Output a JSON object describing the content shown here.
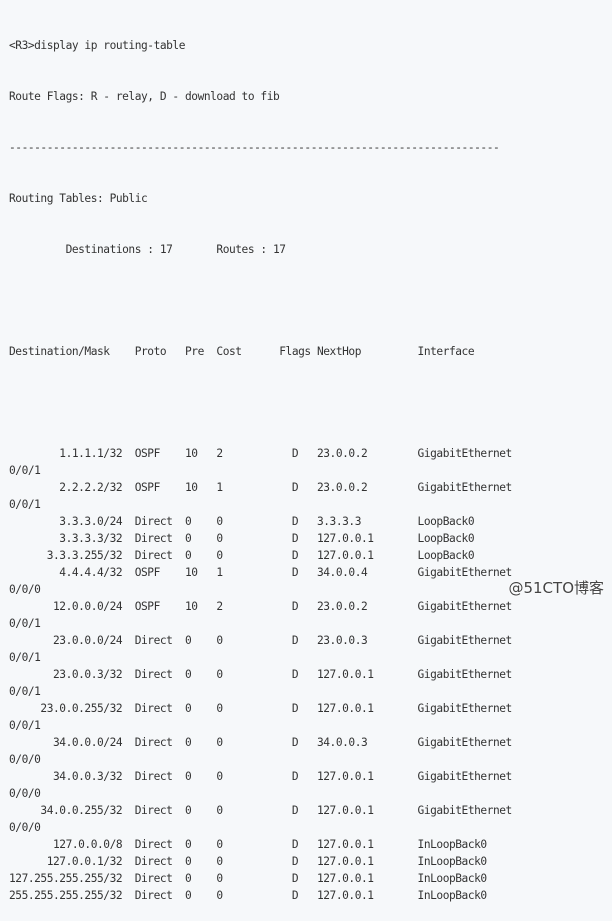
{
  "terminal": {
    "command_line": "<R3>display ip routing-table",
    "route_flags": "Route Flags: R - relay, D - download to fib",
    "separator": "------------------------------------------------------------------------------",
    "table_name": "Routing Tables: Public",
    "summary": "         Destinations : 17       Routes : 17",
    "header": "Destination/Mask    Proto   Pre  Cost      Flags NextHop         Interface",
    "routes": [
      {
        "dest": "1.1.1.1/32",
        "proto": "OSPF",
        "pre": "10",
        "cost": "2",
        "flags": "D",
        "nexthop": "23.0.0.2",
        "iface": "GigabitEthernet",
        "iface_cont": "0/0/1"
      },
      {
        "dest": "2.2.2.2/32",
        "proto": "OSPF",
        "pre": "10",
        "cost": "1",
        "flags": "D",
        "nexthop": "23.0.0.2",
        "iface": "GigabitEthernet",
        "iface_cont": "0/0/1"
      },
      {
        "dest": "3.3.3.0/24",
        "proto": "Direct",
        "pre": "0",
        "cost": "0",
        "flags": "D",
        "nexthop": "3.3.3.3",
        "iface": "LoopBack0",
        "iface_cont": ""
      },
      {
        "dest": "3.3.3.3/32",
        "proto": "Direct",
        "pre": "0",
        "cost": "0",
        "flags": "D",
        "nexthop": "127.0.0.1",
        "iface": "LoopBack0",
        "iface_cont": ""
      },
      {
        "dest": "3.3.3.255/32",
        "proto": "Direct",
        "pre": "0",
        "cost": "0",
        "flags": "D",
        "nexthop": "127.0.0.1",
        "iface": "LoopBack0",
        "iface_cont": ""
      },
      {
        "dest": "4.4.4.4/32",
        "proto": "OSPF",
        "pre": "10",
        "cost": "1",
        "flags": "D",
        "nexthop": "34.0.0.4",
        "iface": "GigabitEthernet",
        "iface_cont": "0/0/0"
      },
      {
        "dest": "12.0.0.0/24",
        "proto": "OSPF",
        "pre": "10",
        "cost": "2",
        "flags": "D",
        "nexthop": "23.0.0.2",
        "iface": "GigabitEthernet",
        "iface_cont": "0/0/1"
      },
      {
        "dest": "23.0.0.0/24",
        "proto": "Direct",
        "pre": "0",
        "cost": "0",
        "flags": "D",
        "nexthop": "23.0.0.3",
        "iface": "GigabitEthernet",
        "iface_cont": "0/0/1"
      },
      {
        "dest": "23.0.0.3/32",
        "proto": "Direct",
        "pre": "0",
        "cost": "0",
        "flags": "D",
        "nexthop": "127.0.0.1",
        "iface": "GigabitEthernet",
        "iface_cont": "0/0/1"
      },
      {
        "dest": "23.0.0.255/32",
        "proto": "Direct",
        "pre": "0",
        "cost": "0",
        "flags": "D",
        "nexthop": "127.0.0.1",
        "iface": "GigabitEthernet",
        "iface_cont": "0/0/1"
      },
      {
        "dest": "34.0.0.0/24",
        "proto": "Direct",
        "pre": "0",
        "cost": "0",
        "flags": "D",
        "nexthop": "34.0.0.3",
        "iface": "GigabitEthernet",
        "iface_cont": "0/0/0"
      },
      {
        "dest": "34.0.0.3/32",
        "proto": "Direct",
        "pre": "0",
        "cost": "0",
        "flags": "D",
        "nexthop": "127.0.0.1",
        "iface": "GigabitEthernet",
        "iface_cont": "0/0/0"
      },
      {
        "dest": "34.0.0.255/32",
        "proto": "Direct",
        "pre": "0",
        "cost": "0",
        "flags": "D",
        "nexthop": "127.0.0.1",
        "iface": "GigabitEthernet",
        "iface_cont": "0/0/0"
      },
      {
        "dest": "127.0.0.0/8",
        "proto": "Direct",
        "pre": "0",
        "cost": "0",
        "flags": "D",
        "nexthop": "127.0.0.1",
        "iface": "InLoopBack0",
        "iface_cont": ""
      },
      {
        "dest": "127.0.0.1/32",
        "proto": "Direct",
        "pre": "0",
        "cost": "0",
        "flags": "D",
        "nexthop": "127.0.0.1",
        "iface": "InLoopBack0",
        "iface_cont": ""
      },
      {
        "dest": "127.255.255.255/32",
        "proto": "Direct",
        "pre": "0",
        "cost": "0",
        "flags": "D",
        "nexthop": "127.0.0.1",
        "iface": "InLoopBack0",
        "iface_cont": ""
      },
      {
        "dest": "255.255.255.255/32",
        "proto": "Direct",
        "pre": "0",
        "cost": "0",
        "flags": "D",
        "nexthop": "127.0.0.1",
        "iface": "InLoopBack0",
        "iface_cont": ""
      }
    ]
  },
  "watermark": "@51CTO博客"
}
